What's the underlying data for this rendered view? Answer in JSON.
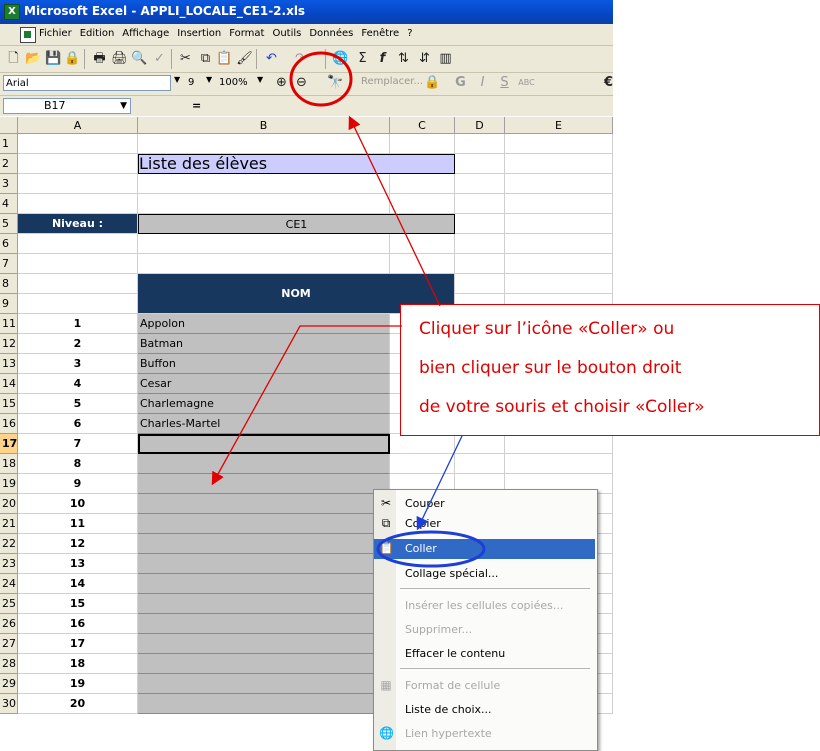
{
  "window": {
    "title": "Microsoft Excel - APPLI_LOCALE_CE1-2.xls",
    "app_icon": "X"
  },
  "menu": [
    "Fichier",
    "Edition",
    "Affichage",
    "Insertion",
    "Format",
    "Outils",
    "Données",
    "Fenêtre",
    "?"
  ],
  "toolbar2": {
    "font": "Arial",
    "size": "9",
    "zoom": "100%",
    "replace": "Remplacer..."
  },
  "formula_bar": {
    "name_box": "B17",
    "equals": "="
  },
  "columns": [
    "A",
    "B",
    "C",
    "D",
    "E"
  ],
  "rows": [
    "1",
    "2",
    "3",
    "4",
    "5",
    "6",
    "7",
    "8",
    "9",
    "11",
    "12",
    "13",
    "14",
    "15",
    "16",
    "17",
    "18",
    "19",
    "20",
    "21",
    "22",
    "23",
    "24",
    "25",
    "26",
    "27",
    "28",
    "29",
    "30"
  ],
  "sheet": {
    "title": "Liste des élèves",
    "niveau_label": "Niveau :",
    "niveau_value": "CE1",
    "nom_header": "NOM",
    "students": [
      {
        "num": "1",
        "name": "Appolon"
      },
      {
        "num": "2",
        "name": "Batman"
      },
      {
        "num": "3",
        "name": "Buffon"
      },
      {
        "num": "4",
        "name": "Cesar"
      },
      {
        "num": "5",
        "name": "Charlemagne"
      },
      {
        "num": "6",
        "name": "Charles-Martel"
      },
      {
        "num": "7",
        "name": ""
      },
      {
        "num": "8",
        "name": ""
      },
      {
        "num": "9",
        "name": ""
      },
      {
        "num": "10",
        "name": ""
      },
      {
        "num": "11",
        "name": ""
      },
      {
        "num": "12",
        "name": ""
      },
      {
        "num": "13",
        "name": ""
      },
      {
        "num": "14",
        "name": ""
      },
      {
        "num": "15",
        "name": ""
      },
      {
        "num": "16",
        "name": ""
      },
      {
        "num": "17",
        "name": ""
      },
      {
        "num": "18",
        "name": ""
      },
      {
        "num": "19",
        "name": ""
      },
      {
        "num": "20",
        "name": ""
      }
    ]
  },
  "context_menu": [
    {
      "label": "Couper",
      "icon": "scissors-icon",
      "state": "normal"
    },
    {
      "label": "Copier",
      "icon": "copy-icon",
      "state": "normal"
    },
    {
      "label": "Coller",
      "icon": "paste-icon",
      "state": "active"
    },
    {
      "label": "Collage spécial...",
      "icon": "",
      "state": "normal"
    },
    {
      "label": "Insérer les cellules copiées...",
      "icon": "",
      "state": "disabled"
    },
    {
      "label": "Supprimer...",
      "icon": "",
      "state": "disabled"
    },
    {
      "label": "Effacer le contenu",
      "icon": "",
      "state": "normal"
    },
    {
      "label": "Format de cellule",
      "icon": "format-cells-icon",
      "state": "disabled"
    },
    {
      "label": "Liste de choix...",
      "icon": "",
      "state": "normal"
    },
    {
      "label": "Lien hypertexte",
      "icon": "hyperlink-icon",
      "state": "disabled"
    }
  ],
  "callout": {
    "line1": "Cliquer sur l’icône «Coller» ou",
    "line2": "bien cliquer sur le bouton droit",
    "line3": "de votre souris et choisir «Coller»"
  },
  "colors": {
    "annotation_red": "#e00000",
    "annotation_blue": "#1d3fd6",
    "nom_header_bg": "#17375e",
    "title_bg": "#ccccff",
    "cell_gray": "#c0c0c0",
    "menu_highlight": "#316ac5"
  }
}
